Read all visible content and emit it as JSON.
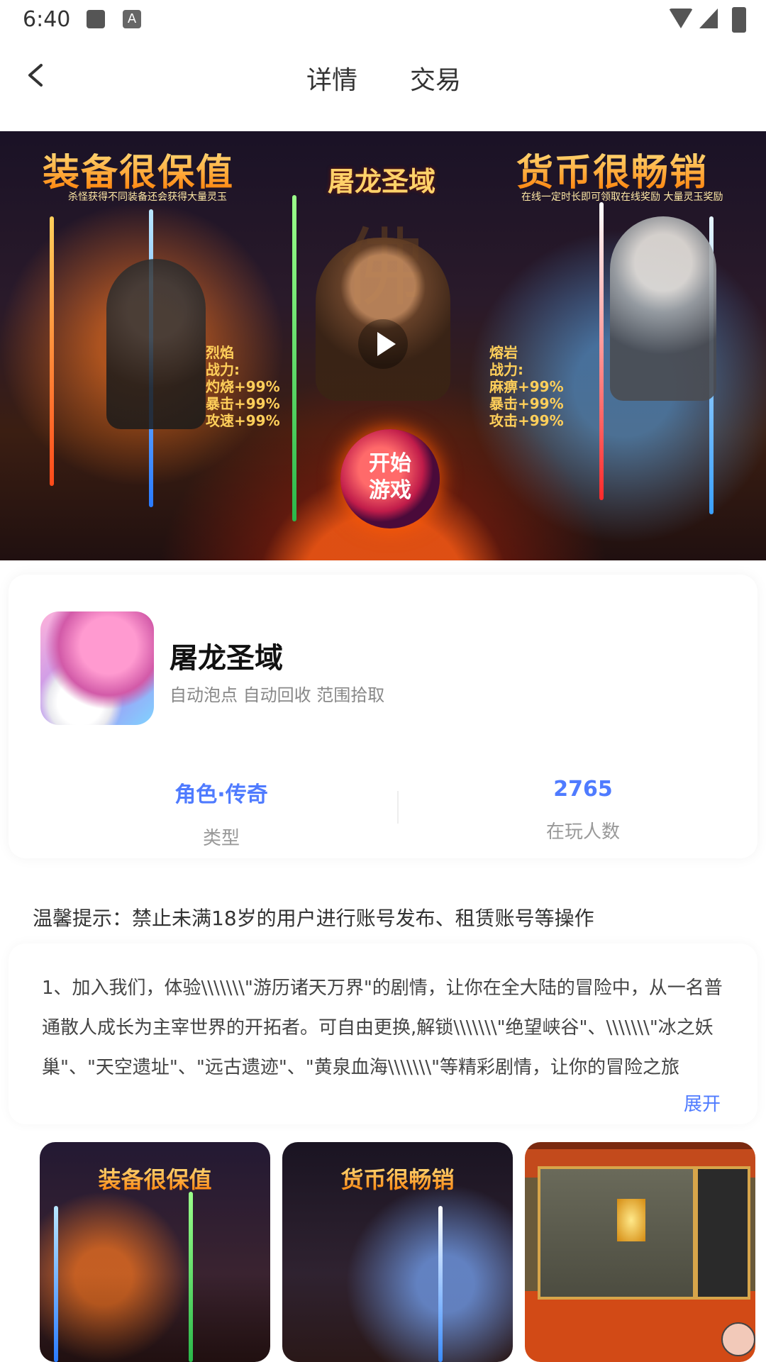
{
  "status_bar": {
    "time": "6:40",
    "icons": [
      "image-icon",
      "ime-icon",
      "wifi-icon",
      "signal-icon",
      "battery-icon"
    ]
  },
  "header": {
    "tabs": [
      {
        "label": "详情",
        "active": true
      },
      {
        "label": "交易",
        "active": false
      }
    ]
  },
  "hero": {
    "title_left": "装备很保值",
    "subtitle_left": "杀怪获得不同装备还会获得大量灵玉",
    "title_right": "货币很畅销",
    "subtitle_right": "在线一定时长即可领取在线奖励 大量灵玉奖励",
    "logo_text": "屠龙圣域",
    "center_char": "佛",
    "start_button": "开始\n游戏",
    "stat_left": "烈焰\n战力:\n灼烧+99%\n暴击+99%\n攻速+99%",
    "stat_right": "熔岩\n战力:\n麻痹+99%\n暴击+99%\n攻击+99%"
  },
  "app": {
    "name": "屠龙圣域",
    "tags": "自动泡点 自动回收 范围拾取",
    "type_value": "角色·传奇",
    "type_label": "类型",
    "players_value": "2765",
    "players_label": "在玩人数"
  },
  "tip": "温馨提示：禁止未满18岁的用户进行账号发布、租赁账号等操作",
  "description": {
    "text": "1、加入我们，体验\\\\\\\\\\\\\\\"游历诸天万界\"的剧情，让你在全大陆的冒险中，从一名普通散人成长为主宰世界的开拓者。可自由更换,解锁\\\\\\\\\\\\\\\"绝望峡谷\"、\\\\\\\\\\\\\\\"冰之妖巢\"、\"天空遗址\"、\"远古遗迹\"、\"黄泉血海\\\\\\\\\\\\\\\"等精彩剧情，让你的冒险之旅",
    "expand_label": "展开"
  },
  "screenshots": [
    {
      "caption": "装备很保值"
    },
    {
      "caption": "货币很畅销"
    },
    {
      "caption": ""
    }
  ],
  "colors": {
    "accent": "#4f7bff",
    "muted": "#999999"
  }
}
